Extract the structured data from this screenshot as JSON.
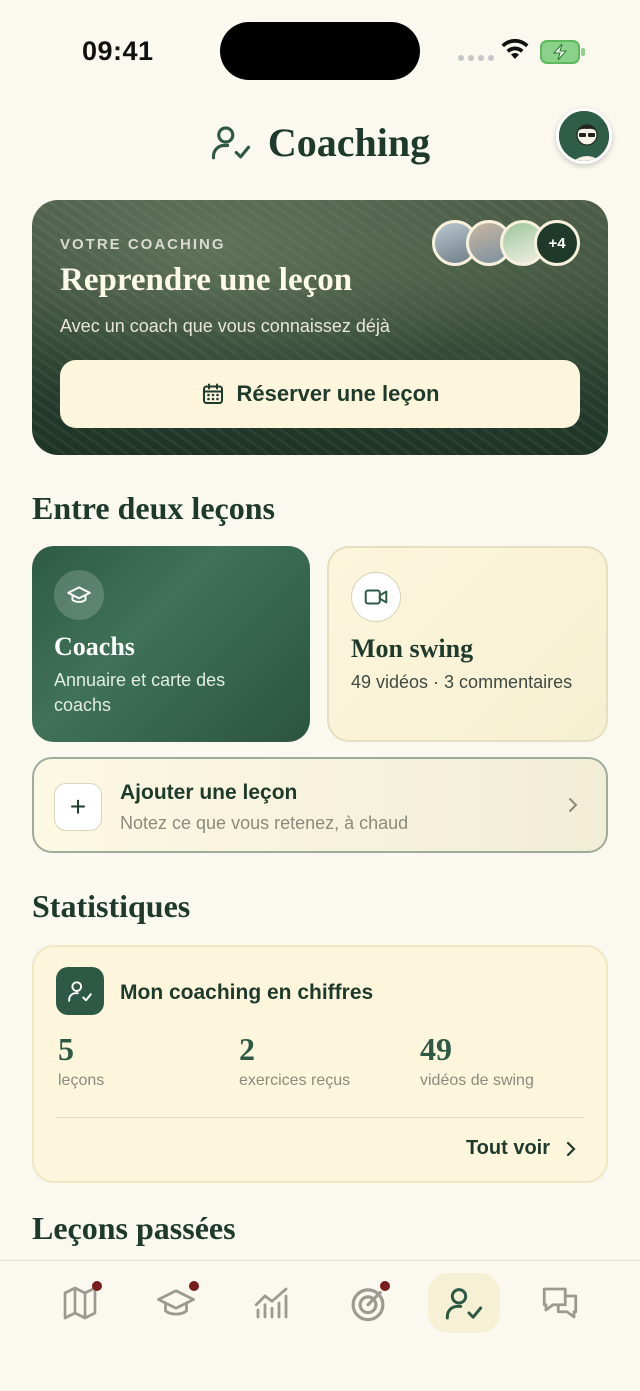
{
  "status_bar": {
    "time": "09:41"
  },
  "header": {
    "title": "Coaching"
  },
  "hero": {
    "eyebrow": "VOTRE COACHING",
    "heading": "Reprendre une leçon",
    "subtitle": "Avec un coach que vous connaissez déjà",
    "cta_label": "Réserver une leçon",
    "more_coaches": "+4"
  },
  "between": {
    "title": "Entre deux leçons",
    "coachs": {
      "title": "Coachs",
      "desc": "Annuaire et carte des coachs"
    },
    "swing": {
      "title": "Mon swing",
      "desc": "49 vidéos · 3 commentaires"
    },
    "add": {
      "title": "Ajouter une leçon",
      "desc": "Notez ce que vous retenez, à chaud"
    }
  },
  "stats": {
    "title": "Statistiques",
    "card_title": "Mon coaching en chiffres",
    "items": [
      {
        "value": "5",
        "label": "leçons"
      },
      {
        "value": "2",
        "label": "exercices reçus"
      },
      {
        "value": "49",
        "label": "vidéos de swing"
      }
    ],
    "see_all": "Tout voir"
  },
  "past": {
    "title": "Leçons passées"
  },
  "tabbar": {
    "tabs": [
      {
        "icon": "map-icon",
        "badge": true
      },
      {
        "icon": "graduation-cap-icon",
        "badge": true
      },
      {
        "icon": "stats-chart-icon",
        "badge": false
      },
      {
        "icon": "target-icon",
        "badge": true
      },
      {
        "icon": "user-check-icon",
        "badge": false,
        "active": true
      },
      {
        "icon": "chat-bubbles-icon",
        "badge": false
      }
    ]
  },
  "colors": {
    "accent": "#2e5a45",
    "background": "#fbf9ef",
    "cream": "#fdf6dc",
    "badge": "#7a1c1c"
  }
}
